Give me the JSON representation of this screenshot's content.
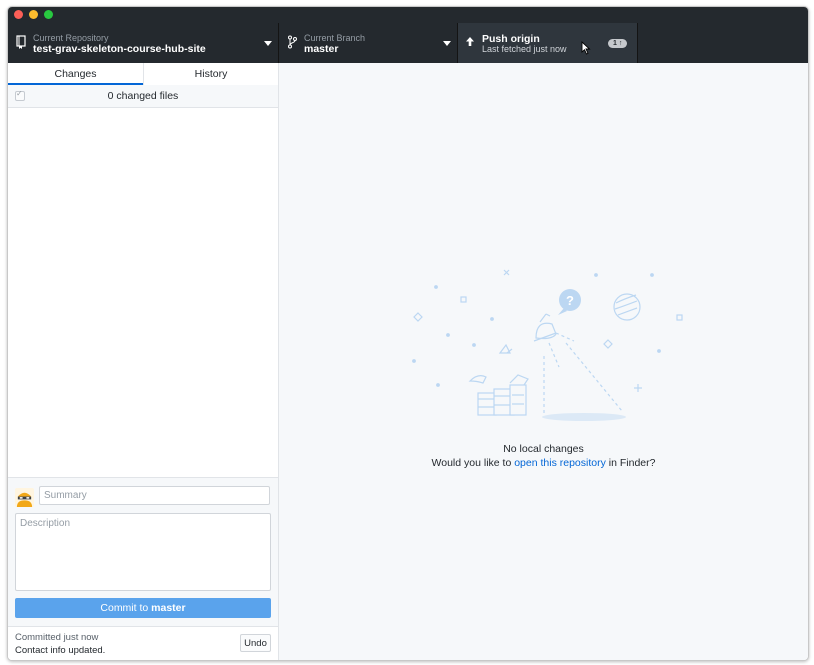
{
  "toolbar": {
    "repo": {
      "label": "Current Repository",
      "value": "test-grav-skeleton-course-hub-site"
    },
    "branch": {
      "label": "Current Branch",
      "value": "master"
    },
    "push": {
      "title": "Push origin",
      "status": "Last fetched just now",
      "badge": "1 ↑"
    }
  },
  "sidebar": {
    "tabs": {
      "changes": "Changes",
      "history": "History"
    },
    "changed_files": "0 changed files",
    "commit": {
      "summary_placeholder": "Summary",
      "description_placeholder": "Description",
      "button_prefix": "Commit to",
      "button_branch": "master"
    },
    "undo": {
      "when": "Committed just now",
      "message": "Contact info updated.",
      "button": "Undo"
    }
  },
  "main": {
    "title": "No local changes",
    "prompt_before": "Would you like to ",
    "prompt_link": "open this repository",
    "prompt_after": " in Finder?"
  },
  "colors": {
    "toolbar_bg": "#24292e",
    "accent": "#0366d6",
    "commit_button": "#5aa3ec",
    "illustration": "#bcd7f2"
  }
}
